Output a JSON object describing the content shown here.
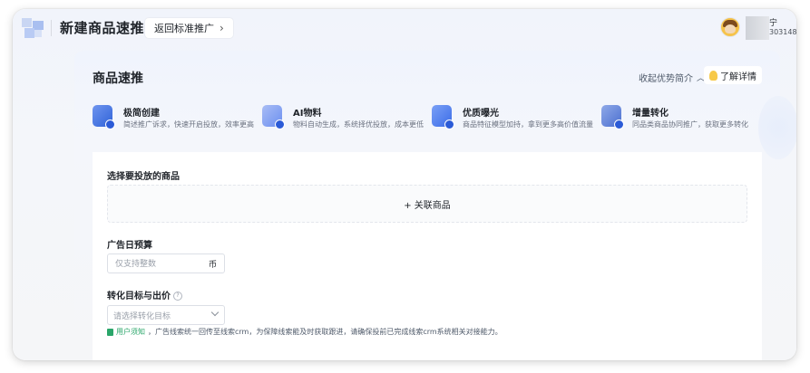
{
  "header": {
    "title": "新建商品速推",
    "back_label": "返回标准推广",
    "user_name": "宁",
    "user_id": "303148"
  },
  "card": {
    "title": "商品速推",
    "collapse_label": "收起优势简介",
    "detail_label": "了解详情"
  },
  "features": [
    {
      "title": "极简创建",
      "desc": "简述推广诉求，快速开启投放，效率更高",
      "icon": "edit-icon",
      "color": "#3a6fe0"
    },
    {
      "title": "AI物料",
      "desc": "物料自动生成，系统择优投放，成本更低",
      "icon": "ai-material-icon",
      "color": "#6b8ff0"
    },
    {
      "title": "优质曝光",
      "desc": "商品特征模型加持，拿到更多高价值流量",
      "icon": "video-icon",
      "color": "#4a7cf2"
    },
    {
      "title": "增量转化",
      "desc": "同品类商品协同推广，获取更多转化",
      "icon": "growth-icon",
      "color": "#5a7ed8"
    }
  ],
  "form": {
    "product_label": "选择要投放的商品",
    "link_product": "+ 关联商品",
    "budget_label": "广告日预算",
    "budget_placeholder": "仅支持整数",
    "budget_unit": "币",
    "target_label": "转化目标与出价",
    "target_placeholder": "请选择转化目标",
    "notice_prefix": "用户须知",
    "notice_text": "，广告线索统一回传至线索crm，为保障线索能及时获取跟进，请确保投前已完成线索crm系统相关对接能力。"
  }
}
